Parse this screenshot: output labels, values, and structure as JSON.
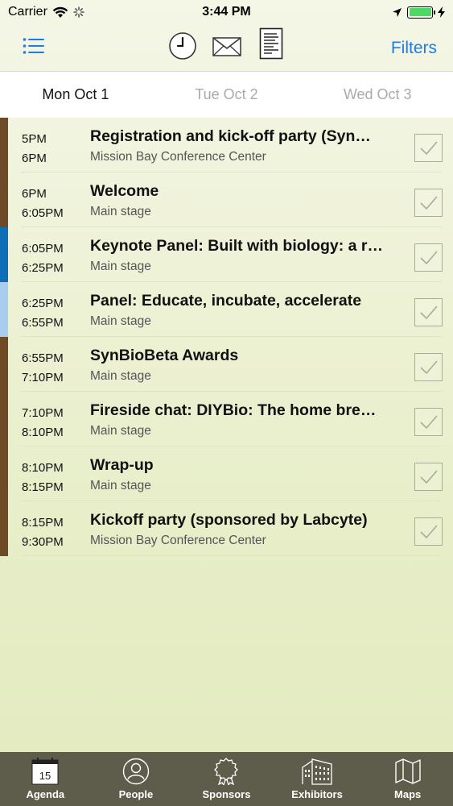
{
  "status_bar": {
    "carrier": "Carrier",
    "time": "3:44 PM"
  },
  "toolbar": {
    "filters_label": "Filters",
    "accent_color": "#1a7cf0"
  },
  "day_tabs": [
    {
      "label": "Mon Oct 1",
      "active": true
    },
    {
      "label": "Tue Oct 2",
      "active": false
    },
    {
      "label": "Wed Oct 3",
      "active": false
    }
  ],
  "sessions": [
    {
      "start": "5PM",
      "end": "6PM",
      "title": "Registration and kick-off party (Syn…",
      "location": "Mission Bay Conference Center",
      "color": "#6e4a26"
    },
    {
      "start": "6PM",
      "end": "6:05PM",
      "title": "Welcome",
      "location": "Main stage",
      "color": "#6e4a26"
    },
    {
      "start": "6:05PM",
      "end": "6:25PM",
      "title": "Keynote Panel: Built with biology: a r…",
      "location": "Main stage",
      "color": "#0d6fb8"
    },
    {
      "start": "6:25PM",
      "end": "6:55PM",
      "title": "Panel: Educate, incubate, accelerate",
      "location": "Main stage",
      "color": "#a9cdef"
    },
    {
      "start": "6:55PM",
      "end": "7:10PM",
      "title": "SynBioBeta Awards",
      "location": "Main stage",
      "color": "#6e4a26"
    },
    {
      "start": "7:10PM",
      "end": "8:10PM",
      "title": "Fireside chat: DIYBio: The home bre…",
      "location": "Main stage",
      "color": "#6e4a26"
    },
    {
      "start": "8:10PM",
      "end": "8:15PM",
      "title": "Wrap-up",
      "location": "Main stage",
      "color": "#6e4a26"
    },
    {
      "start": "8:15PM",
      "end": "9:30PM",
      "title": "Kickoff party (sponsored by Labcyte)",
      "location": "Mission Bay Conference Center",
      "color": "#6e4a26"
    }
  ],
  "tab_bar": {
    "calendar_day": "15",
    "items": [
      {
        "label": "Agenda",
        "icon": "calendar-icon"
      },
      {
        "label": "People",
        "icon": "person-icon"
      },
      {
        "label": "Sponsors",
        "icon": "ribbon-icon"
      },
      {
        "label": "Exhibitors",
        "icon": "building-icon"
      },
      {
        "label": "Maps",
        "icon": "map-icon"
      }
    ]
  }
}
